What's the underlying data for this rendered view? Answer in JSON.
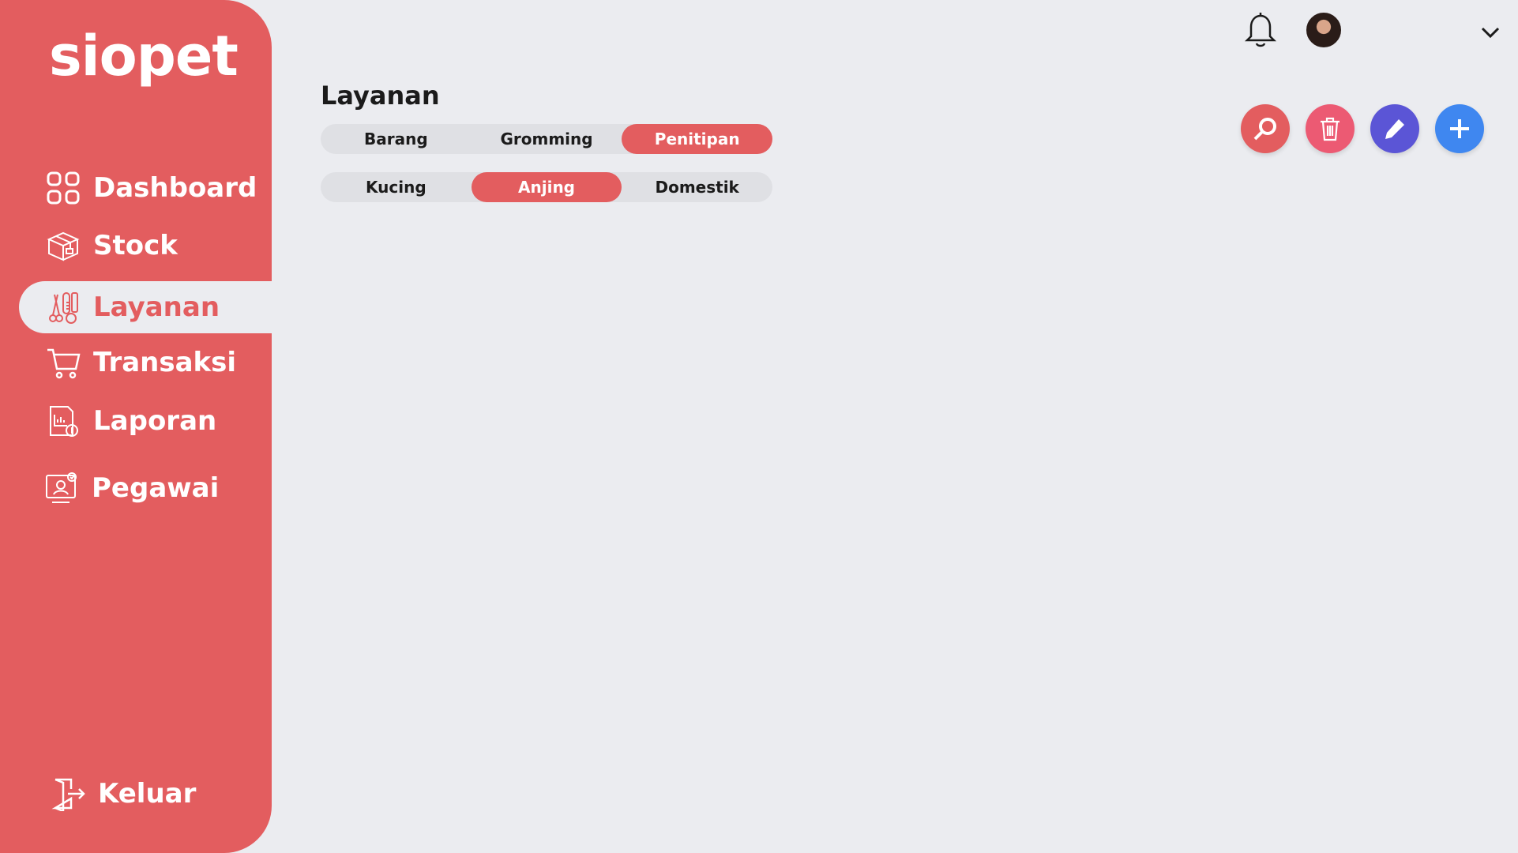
{
  "app": {
    "logo": "siopet"
  },
  "sidebar": {
    "items": [
      {
        "label": "Dashboard",
        "icon": "grid-icon",
        "active": false
      },
      {
        "label": "Stock",
        "icon": "box-icon",
        "active": false
      },
      {
        "label": "Layanan",
        "icon": "grooming-tools-icon",
        "active": true
      },
      {
        "label": "Transaksi",
        "icon": "cart-icon",
        "active": false
      },
      {
        "label": "Laporan",
        "icon": "report-icon",
        "active": false
      },
      {
        "label": "Pegawai",
        "icon": "employee-icon",
        "active": false
      }
    ],
    "logout": {
      "label": "Keluar",
      "icon": "logout-door-icon"
    }
  },
  "main": {
    "title": "Layanan",
    "service_tabs": [
      {
        "label": "Barang",
        "active": false
      },
      {
        "label": "Gromming",
        "active": false
      },
      {
        "label": "Penitipan",
        "active": true
      }
    ],
    "animal_tabs": [
      {
        "label": "Kucing",
        "active": false
      },
      {
        "label": "Anjing",
        "active": true
      },
      {
        "label": "Domestik",
        "active": false
      }
    ]
  },
  "actions": [
    {
      "name": "search",
      "icon": "search-icon",
      "color": "#e35d5f"
    },
    {
      "name": "delete",
      "icon": "trash-icon",
      "color": "#ec5a73"
    },
    {
      "name": "edit",
      "icon": "pencil-icon",
      "color": "#5b55d6"
    },
    {
      "name": "add",
      "icon": "plus-icon",
      "color": "#3f87f0"
    }
  ],
  "colors": {
    "accent": "#e35d5f",
    "background": "#ebecf0"
  }
}
